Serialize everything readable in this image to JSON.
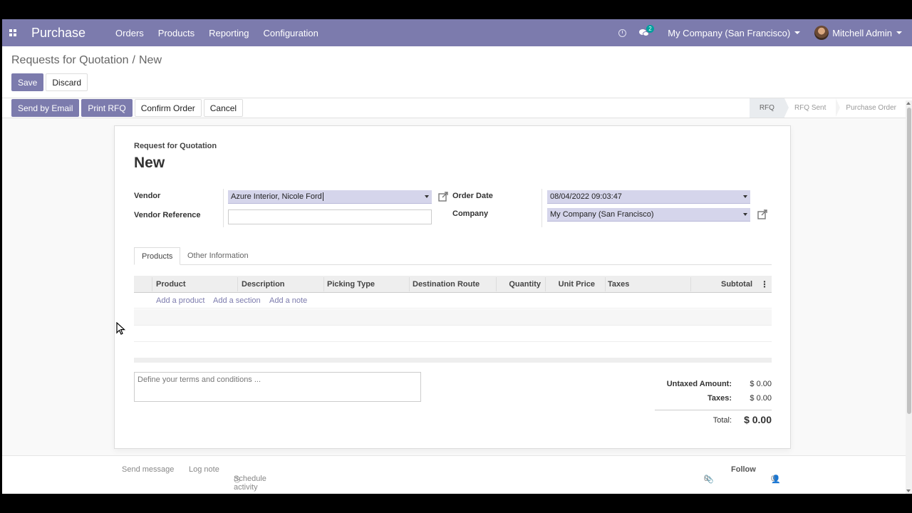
{
  "navbar": {
    "app_name": "Purchase",
    "menu": [
      "Orders",
      "Products",
      "Reporting",
      "Configuration"
    ],
    "message_count": "2",
    "company": "My Company (San Francisco)",
    "user": "Mitchell Admin"
  },
  "breadcrumb": {
    "parent": "Requests for Quotation",
    "separator": "/",
    "current": "New"
  },
  "control": {
    "save_label": "Save",
    "discard_label": "Discard"
  },
  "statusbar": {
    "buttons": [
      "Send by Email",
      "Print RFQ",
      "Confirm Order",
      "Cancel"
    ],
    "stages": [
      "RFQ",
      "RFQ Sent",
      "Purchase Order"
    ],
    "active_stage": "RFQ"
  },
  "form": {
    "subtitle": "Request for Quotation",
    "title": "New",
    "vendor_label": "Vendor",
    "vendor_value": "Azure Interior, Nicole Ford",
    "vendor_ref_label": "Vendor Reference",
    "vendor_ref_value": "",
    "order_date_label": "Order Date",
    "order_date_value": "08/04/2022 09:03:47",
    "company_label": "Company",
    "company_value": "My Company (San Francisco)"
  },
  "tabs": [
    "Products",
    "Other Information"
  ],
  "table": {
    "columns": [
      "Product",
      "Description",
      "Picking Type",
      "Destination Route",
      "Quantity",
      "Unit Price",
      "Taxes",
      "Subtotal"
    ],
    "add_links": [
      "Add a product",
      "Add a section",
      "Add a note"
    ]
  },
  "terms_placeholder": "Define your terms and conditions ...",
  "totals": {
    "untaxed_label": "Untaxed Amount:",
    "untaxed_value": "$ 0.00",
    "taxes_label": "Taxes:",
    "taxes_value": "$ 0.00",
    "total_label": "Total:",
    "total_value": "$ 0.00"
  },
  "chatter": {
    "send_message": "Send message",
    "log_note": "Log note",
    "schedule_activity": "Schedule activity",
    "attachments": "0",
    "follow": "Follow",
    "followers": "0"
  },
  "colors": {
    "brand": "#7c7bad",
    "input_bg": "#d5d5eb",
    "badge": "#00a09d"
  }
}
